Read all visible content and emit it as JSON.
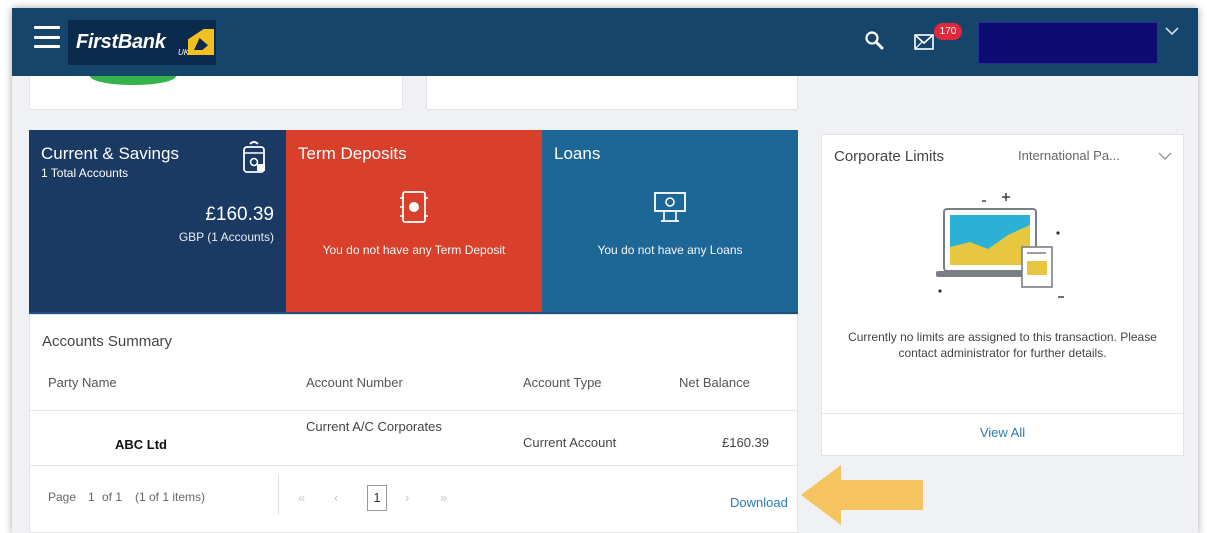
{
  "brand": {
    "name": "FirstBank",
    "region": "UK"
  },
  "header": {
    "notification_count": "170"
  },
  "tiles": {
    "current_savings": {
      "title": "Current & Savings",
      "subtitle": "1 Total Accounts",
      "amount": "£160.39",
      "note": "GBP (1 Accounts)"
    },
    "term_deposits": {
      "title": "Term Deposits",
      "message": "You do not have any Term Deposit"
    },
    "loans": {
      "title": "Loans",
      "message": "You do not have any Loans"
    }
  },
  "summary": {
    "title": "Accounts Summary",
    "columns": [
      "Party Name",
      "Account Number",
      "Account Type",
      "Net Balance"
    ],
    "rows": [
      {
        "party": "ABC Ltd",
        "account_number": "Current A/C Corporates",
        "account_type": "Current Account",
        "net_balance": "£160.39"
      }
    ],
    "pager": {
      "page_label": "Page",
      "page": "1",
      "of_label": "of 1",
      "items": "(1 of 1 items)",
      "current": "1",
      "first": "«",
      "prev": "‹",
      "next": "›",
      "last": "»"
    },
    "download": "Download"
  },
  "limits": {
    "title": "Corporate Limits",
    "selected": "International Pa...",
    "message": "Currently no limits are assigned to this transaction. Please contact administrator for further details.",
    "view_all": "View All"
  },
  "colors": {
    "header": "#16456b",
    "tile_cs": "#1a3963",
    "tile_td": "#d8402c",
    "tile_ln": "#1d6797",
    "accent_link": "#2a7ab3",
    "arrow": "#f5c45e"
  }
}
